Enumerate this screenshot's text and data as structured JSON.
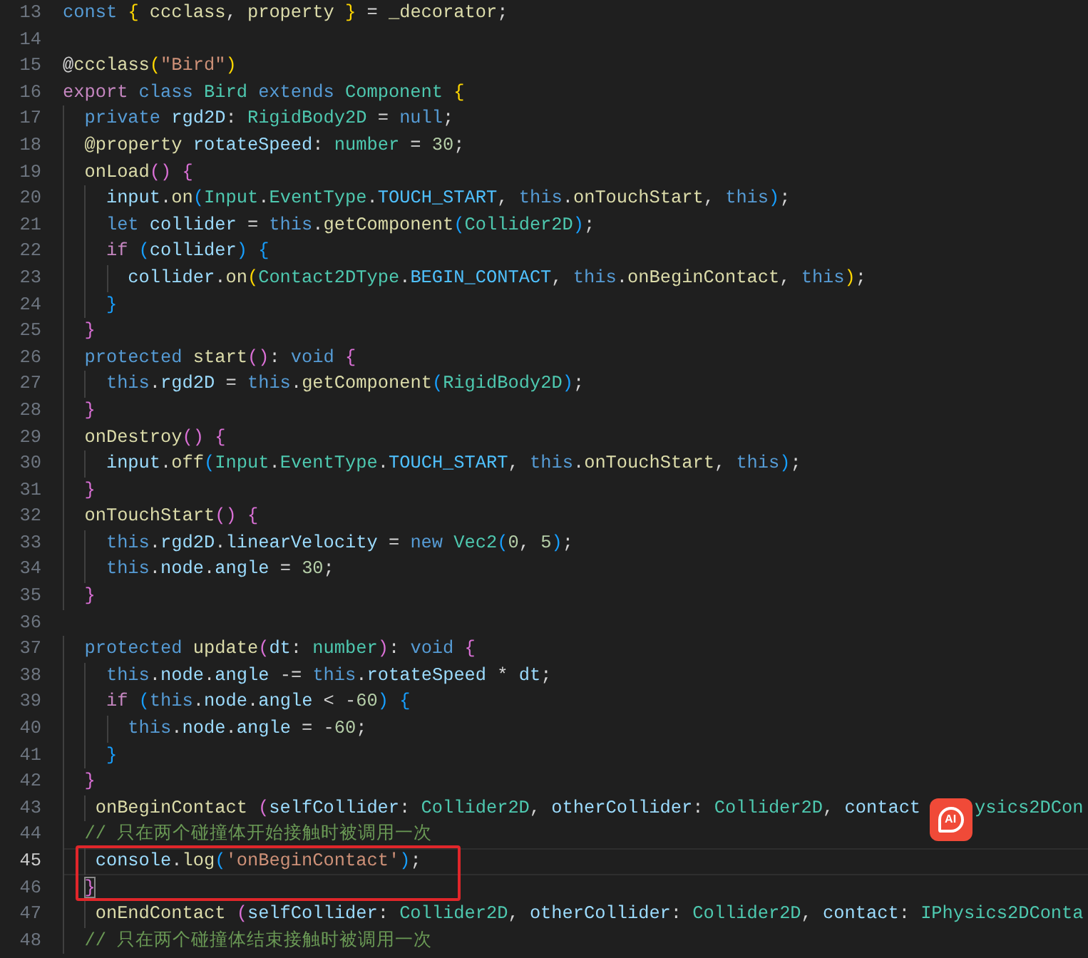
{
  "editor": {
    "lines": [
      {
        "number": "13",
        "current": false,
        "tokens": [
          {
            "text": "const",
            "kind": "kw"
          },
          {
            "text": " {",
            "kind": "b1"
          },
          {
            "text": " ccclass",
            "kind": "fn"
          },
          {
            "text": ", ",
            "kind": "pl"
          },
          {
            "text": "property",
            "kind": "fn"
          },
          {
            "text": " }",
            "kind": "b1"
          },
          {
            "text": " = ",
            "kind": "pl"
          },
          {
            "text": "_decorator",
            "kind": "fn"
          },
          {
            "text": ";",
            "kind": "pl"
          }
        ]
      },
      {
        "number": "14",
        "current": false
      },
      {
        "number": "15",
        "current": false,
        "tokens": [
          {
            "text": "@",
            "kind": "pl"
          },
          {
            "text": "ccclass",
            "kind": "fn"
          },
          {
            "text": "(",
            "kind": "b1"
          },
          {
            "text": "\"Bird\"",
            "kind": "str"
          },
          {
            "text": ")",
            "kind": "b1"
          }
        ]
      },
      {
        "number": "16",
        "current": false,
        "tokens": [
          {
            "text": "export",
            "kind": "ctl"
          },
          {
            "text": " class",
            "kind": "kw"
          },
          {
            "text": " Bird",
            "kind": "type"
          },
          {
            "text": " extends",
            "kind": "kw"
          },
          {
            "text": " Component",
            "kind": "type"
          },
          {
            "text": " {",
            "kind": "b1"
          }
        ]
      },
      {
        "number": "17",
        "current": false,
        "tokens": [
          {
            "text": "  private",
            "kind": "kw"
          },
          {
            "text": " rgd2D",
            "kind": "var"
          },
          {
            "text": ": ",
            "kind": "pl"
          },
          {
            "text": "RigidBody2D",
            "kind": "type"
          },
          {
            "text": " = ",
            "kind": "pl"
          },
          {
            "text": "null",
            "kind": "kw"
          },
          {
            "text": ";",
            "kind": "pl"
          }
        ]
      },
      {
        "number": "18",
        "current": false,
        "tokens": [
          {
            "text": "  @property",
            "kind": "fn"
          },
          {
            "text": " rotateSpeed",
            "kind": "var"
          },
          {
            "text": ": ",
            "kind": "pl"
          },
          {
            "text": "number",
            "kind": "type"
          },
          {
            "text": " = ",
            "kind": "pl"
          },
          {
            "text": "30",
            "kind": "num"
          },
          {
            "text": ";",
            "kind": "pl"
          }
        ]
      },
      {
        "number": "19",
        "current": false,
        "tokens": [
          {
            "text": "  onLoad",
            "kind": "fn"
          },
          {
            "text": "()",
            "kind": "b2"
          },
          {
            "text": " {",
            "kind": "b2"
          }
        ]
      },
      {
        "number": "20",
        "current": false,
        "tokens": [
          {
            "text": "    input",
            "kind": "var"
          },
          {
            "text": ".",
            "kind": "pl"
          },
          {
            "text": "on",
            "kind": "fn"
          },
          {
            "text": "(",
            "kind": "b3"
          },
          {
            "text": "Input",
            "kind": "type"
          },
          {
            "text": ".",
            "kind": "pl"
          },
          {
            "text": "EventType",
            "kind": "type"
          },
          {
            "text": ".",
            "kind": "pl"
          },
          {
            "text": "TOUCH_START",
            "kind": "const"
          },
          {
            "text": ", ",
            "kind": "pl"
          },
          {
            "text": "this",
            "kind": "kw"
          },
          {
            "text": ".",
            "kind": "pl"
          },
          {
            "text": "onTouchStart",
            "kind": "fn"
          },
          {
            "text": ", ",
            "kind": "pl"
          },
          {
            "text": "this",
            "kind": "kw"
          },
          {
            "text": ")",
            "kind": "b3"
          },
          {
            "text": ";",
            "kind": "pl"
          }
        ]
      },
      {
        "number": "21",
        "current": false,
        "tokens": [
          {
            "text": "    let",
            "kind": "kw"
          },
          {
            "text": " collider",
            "kind": "var"
          },
          {
            "text": " = ",
            "kind": "pl"
          },
          {
            "text": "this",
            "kind": "kw"
          },
          {
            "text": ".",
            "kind": "pl"
          },
          {
            "text": "getComponent",
            "kind": "fn"
          },
          {
            "text": "(",
            "kind": "b3"
          },
          {
            "text": "Collider2D",
            "kind": "type"
          },
          {
            "text": ")",
            "kind": "b3"
          },
          {
            "text": ";",
            "kind": "pl"
          }
        ]
      },
      {
        "number": "22",
        "current": false,
        "tokens": [
          {
            "text": "    if",
            "kind": "ctl"
          },
          {
            "text": " (",
            "kind": "b3"
          },
          {
            "text": "collider",
            "kind": "var"
          },
          {
            "text": ")",
            "kind": "b3"
          },
          {
            "text": " {",
            "kind": "b3"
          }
        ]
      },
      {
        "number": "23",
        "current": false,
        "tokens": [
          {
            "text": "      collider",
            "kind": "var"
          },
          {
            "text": ".",
            "kind": "pl"
          },
          {
            "text": "on",
            "kind": "fn"
          },
          {
            "text": "(",
            "kind": "b1"
          },
          {
            "text": "Contact2DType",
            "kind": "type"
          },
          {
            "text": ".",
            "kind": "pl"
          },
          {
            "text": "BEGIN_CONTACT",
            "kind": "const"
          },
          {
            "text": ", ",
            "kind": "pl"
          },
          {
            "text": "this",
            "kind": "kw"
          },
          {
            "text": ".",
            "kind": "pl"
          },
          {
            "text": "onBeginContact",
            "kind": "fn"
          },
          {
            "text": ", ",
            "kind": "pl"
          },
          {
            "text": "this",
            "kind": "kw"
          },
          {
            "text": ")",
            "kind": "b1"
          },
          {
            "text": ";",
            "kind": "pl"
          }
        ]
      },
      {
        "number": "24",
        "current": false,
        "tokens": [
          {
            "text": "    }",
            "kind": "b3"
          }
        ]
      },
      {
        "number": "25",
        "current": false,
        "tokens": [
          {
            "text": "  }",
            "kind": "b2"
          }
        ]
      },
      {
        "number": "26",
        "current": false,
        "tokens": [
          {
            "text": "  protected",
            "kind": "kw"
          },
          {
            "text": " start",
            "kind": "fn"
          },
          {
            "text": "()",
            "kind": "b2"
          },
          {
            "text": ": ",
            "kind": "pl"
          },
          {
            "text": "void",
            "kind": "kw"
          },
          {
            "text": " {",
            "kind": "b2"
          }
        ]
      },
      {
        "number": "27",
        "current": false,
        "tokens": [
          {
            "text": "    this",
            "kind": "kw"
          },
          {
            "text": ".",
            "kind": "pl"
          },
          {
            "text": "rgd2D",
            "kind": "var"
          },
          {
            "text": " = ",
            "kind": "pl"
          },
          {
            "text": "this",
            "kind": "kw"
          },
          {
            "text": ".",
            "kind": "pl"
          },
          {
            "text": "getComponent",
            "kind": "fn"
          },
          {
            "text": "(",
            "kind": "b3"
          },
          {
            "text": "RigidBody2D",
            "kind": "type"
          },
          {
            "text": ")",
            "kind": "b3"
          },
          {
            "text": ";",
            "kind": "pl"
          }
        ]
      },
      {
        "number": "28",
        "current": false,
        "tokens": [
          {
            "text": "  }",
            "kind": "b2"
          }
        ]
      },
      {
        "number": "29",
        "current": false,
        "tokens": [
          {
            "text": "  onDestroy",
            "kind": "fn"
          },
          {
            "text": "()",
            "kind": "b2"
          },
          {
            "text": " {",
            "kind": "b2"
          }
        ]
      },
      {
        "number": "30",
        "current": false,
        "tokens": [
          {
            "text": "    input",
            "kind": "var"
          },
          {
            "text": ".",
            "kind": "pl"
          },
          {
            "text": "off",
            "kind": "fn"
          },
          {
            "text": "(",
            "kind": "b3"
          },
          {
            "text": "Input",
            "kind": "type"
          },
          {
            "text": ".",
            "kind": "pl"
          },
          {
            "text": "EventType",
            "kind": "type"
          },
          {
            "text": ".",
            "kind": "pl"
          },
          {
            "text": "TOUCH_START",
            "kind": "const"
          },
          {
            "text": ", ",
            "kind": "pl"
          },
          {
            "text": "this",
            "kind": "kw"
          },
          {
            "text": ".",
            "kind": "pl"
          },
          {
            "text": "onTouchStart",
            "kind": "fn"
          },
          {
            "text": ", ",
            "kind": "pl"
          },
          {
            "text": "this",
            "kind": "kw"
          },
          {
            "text": ")",
            "kind": "b3"
          },
          {
            "text": ";",
            "kind": "pl"
          }
        ]
      },
      {
        "number": "31",
        "current": false,
        "tokens": [
          {
            "text": "  }",
            "kind": "b2"
          }
        ]
      },
      {
        "number": "32",
        "current": false,
        "tokens": [
          {
            "text": "  onTouchStart",
            "kind": "fn"
          },
          {
            "text": "()",
            "kind": "b2"
          },
          {
            "text": " {",
            "kind": "b2"
          }
        ]
      },
      {
        "number": "33",
        "current": false,
        "tokens": [
          {
            "text": "    this",
            "kind": "kw"
          },
          {
            "text": ".",
            "kind": "pl"
          },
          {
            "text": "rgd2D",
            "kind": "var"
          },
          {
            "text": ".",
            "kind": "pl"
          },
          {
            "text": "linearVelocity",
            "kind": "var"
          },
          {
            "text": " = ",
            "kind": "pl"
          },
          {
            "text": "new",
            "kind": "kw"
          },
          {
            "text": " Vec2",
            "kind": "type"
          },
          {
            "text": "(",
            "kind": "b3"
          },
          {
            "text": "0",
            "kind": "num"
          },
          {
            "text": ", ",
            "kind": "pl"
          },
          {
            "text": "5",
            "kind": "num"
          },
          {
            "text": ")",
            "kind": "b3"
          },
          {
            "text": ";",
            "kind": "pl"
          }
        ]
      },
      {
        "number": "34",
        "current": false,
        "tokens": [
          {
            "text": "    this",
            "kind": "kw"
          },
          {
            "text": ".",
            "kind": "pl"
          },
          {
            "text": "node",
            "kind": "var"
          },
          {
            "text": ".",
            "kind": "pl"
          },
          {
            "text": "angle",
            "kind": "var"
          },
          {
            "text": " = ",
            "kind": "pl"
          },
          {
            "text": "30",
            "kind": "num"
          },
          {
            "text": ";",
            "kind": "pl"
          }
        ]
      },
      {
        "number": "35",
        "current": false,
        "tokens": [
          {
            "text": "  }",
            "kind": "b2"
          }
        ]
      },
      {
        "number": "36",
        "current": false
      },
      {
        "number": "37",
        "current": false,
        "tokens": [
          {
            "text": "  protected",
            "kind": "kw"
          },
          {
            "text": " update",
            "kind": "fn"
          },
          {
            "text": "(",
            "kind": "b2"
          },
          {
            "text": "dt",
            "kind": "var"
          },
          {
            "text": ": ",
            "kind": "pl"
          },
          {
            "text": "number",
            "kind": "type"
          },
          {
            "text": ")",
            "kind": "b2"
          },
          {
            "text": ": ",
            "kind": "pl"
          },
          {
            "text": "void",
            "kind": "kw"
          },
          {
            "text": " {",
            "kind": "b2"
          }
        ]
      },
      {
        "number": "38",
        "current": false,
        "tokens": [
          {
            "text": "    this",
            "kind": "kw"
          },
          {
            "text": ".",
            "kind": "pl"
          },
          {
            "text": "node",
            "kind": "var"
          },
          {
            "text": ".",
            "kind": "pl"
          },
          {
            "text": "angle",
            "kind": "var"
          },
          {
            "text": " -= ",
            "kind": "pl"
          },
          {
            "text": "this",
            "kind": "kw"
          },
          {
            "text": ".",
            "kind": "pl"
          },
          {
            "text": "rotateSpeed",
            "kind": "var"
          },
          {
            "text": " * ",
            "kind": "pl"
          },
          {
            "text": "dt",
            "kind": "var"
          },
          {
            "text": ";",
            "kind": "pl"
          }
        ]
      },
      {
        "number": "39",
        "current": false,
        "tokens": [
          {
            "text": "    if",
            "kind": "ctl"
          },
          {
            "text": " (",
            "kind": "b3"
          },
          {
            "text": "this",
            "kind": "kw"
          },
          {
            "text": ".",
            "kind": "pl"
          },
          {
            "text": "node",
            "kind": "var"
          },
          {
            "text": ".",
            "kind": "pl"
          },
          {
            "text": "angle",
            "kind": "var"
          },
          {
            "text": " < -",
            "kind": "pl"
          },
          {
            "text": "60",
            "kind": "num"
          },
          {
            "text": ")",
            "kind": "b3"
          },
          {
            "text": " {",
            "kind": "b3"
          }
        ]
      },
      {
        "number": "40",
        "current": false,
        "tokens": [
          {
            "text": "      this",
            "kind": "kw"
          },
          {
            "text": ".",
            "kind": "pl"
          },
          {
            "text": "node",
            "kind": "var"
          },
          {
            "text": ".",
            "kind": "pl"
          },
          {
            "text": "angle",
            "kind": "var"
          },
          {
            "text": " = -",
            "kind": "pl"
          },
          {
            "text": "60",
            "kind": "num"
          },
          {
            "text": ";",
            "kind": "pl"
          }
        ]
      },
      {
        "number": "41",
        "current": false,
        "tokens": [
          {
            "text": "    }",
            "kind": "b3"
          }
        ]
      },
      {
        "number": "42",
        "current": false,
        "tokens": [
          {
            "text": "  }",
            "kind": "b2"
          }
        ]
      },
      {
        "number": "43",
        "current": false,
        "tokens": [
          {
            "text": "   onBeginContact",
            "kind": "fn"
          },
          {
            "text": " (",
            "kind": "b2"
          },
          {
            "text": "selfCollider",
            "kind": "var"
          },
          {
            "text": ": ",
            "kind": "pl"
          },
          {
            "text": "Collider2D",
            "kind": "type"
          },
          {
            "text": ", ",
            "kind": "pl"
          },
          {
            "text": "otherCollider",
            "kind": "var"
          },
          {
            "text": ": ",
            "kind": "pl"
          },
          {
            "text": "Collider2D",
            "kind": "type"
          },
          {
            "text": ", ",
            "kind": "pl"
          },
          {
            "text": "contact",
            "kind": "var"
          }
        ],
        "ai_badge": {
          "label": "AI"
        },
        "tail_tokens": [
          {
            "text": "ysics2DCon",
            "kind": "type"
          }
        ]
      },
      {
        "number": "44",
        "current": false,
        "tokens": [
          {
            "text": "  // 只在两个碰撞体开始接触时被调用一次",
            "kind": "com"
          }
        ]
      },
      {
        "number": "45",
        "current": true,
        "tokens": [
          {
            "text": "   console",
            "kind": "var"
          },
          {
            "text": ".",
            "kind": "pl"
          },
          {
            "text": "log",
            "kind": "fn"
          },
          {
            "text": "(",
            "kind": "b3"
          },
          {
            "text": "'onBeginContact'",
            "kind": "str"
          },
          {
            "text": ")",
            "kind": "b3"
          },
          {
            "text": ";",
            "kind": "pl"
          }
        ]
      },
      {
        "number": "46",
        "current": false,
        "tokens": [
          {
            "text": "  }",
            "kind": "match"
          }
        ]
      },
      {
        "number": "47",
        "current": false,
        "tokens": [
          {
            "text": "   onEndContact",
            "kind": "fn"
          },
          {
            "text": " (",
            "kind": "b2"
          },
          {
            "text": "selfCollider",
            "kind": "var"
          },
          {
            "text": ": ",
            "kind": "pl"
          },
          {
            "text": "Collider2D",
            "kind": "type"
          },
          {
            "text": ", ",
            "kind": "pl"
          },
          {
            "text": "otherCollider",
            "kind": "var"
          },
          {
            "text": ": ",
            "kind": "pl"
          },
          {
            "text": "Collider2D",
            "kind": "type"
          },
          {
            "text": ", ",
            "kind": "pl"
          },
          {
            "text": "contact",
            "kind": "var"
          },
          {
            "text": ": ",
            "kind": "pl"
          },
          {
            "text": "IPhysics2DConta",
            "kind": "type"
          }
        ]
      },
      {
        "number": "48",
        "current": false,
        "tokens": [
          {
            "text": "  // 只在两个碰撞体结束接触时被调用一次",
            "kind": "com"
          }
        ]
      }
    ]
  }
}
